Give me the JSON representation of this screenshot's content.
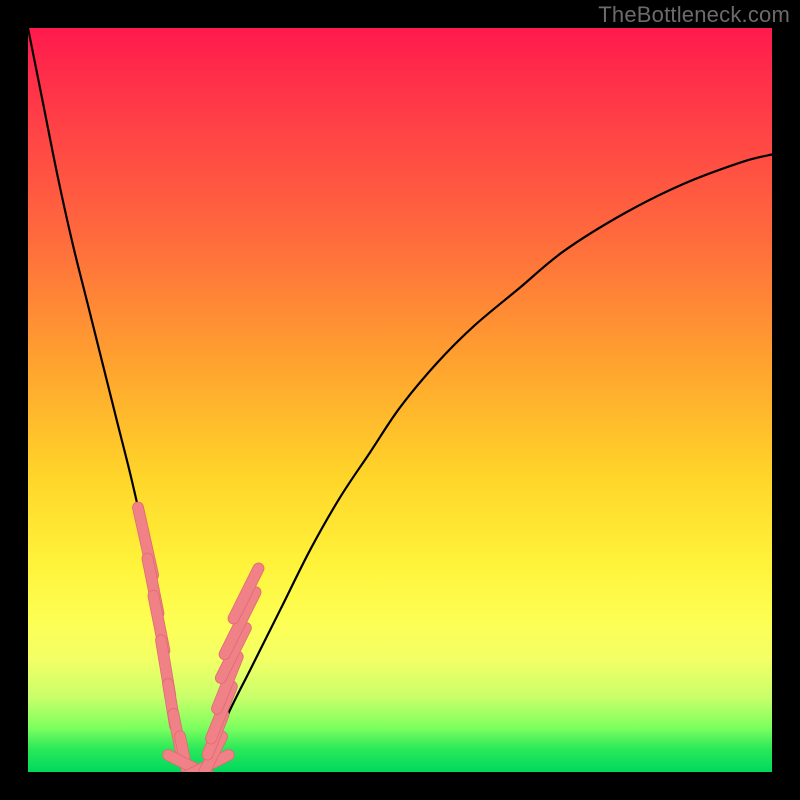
{
  "watermark": "TheBottleneck.com",
  "colors": {
    "frame": "#000000",
    "gradient_top": "#ff1a4d",
    "gradient_mid": "#ffd429",
    "gradient_bottom": "#00d95c",
    "curve": "#000000",
    "marker_fill": "#ef8187",
    "marker_stroke": "#e06a72"
  },
  "chart_data": {
    "type": "line",
    "title": "",
    "xlabel": "",
    "ylabel": "",
    "xlim": [
      0,
      100
    ],
    "ylim": [
      0,
      100
    ],
    "grid": false,
    "legend": null,
    "series": [
      {
        "name": "curve",
        "x": [
          0,
          2,
          4,
          6,
          8,
          10,
          12,
          14,
          16,
          18,
          19,
          20,
          21,
          22,
          23,
          24,
          25,
          27,
          30,
          34,
          38,
          42,
          46,
          50,
          55,
          60,
          66,
          72,
          80,
          88,
          96,
          100
        ],
        "y": [
          100,
          90,
          80,
          71,
          63,
          55,
          47,
          39,
          30,
          20,
          14,
          8,
          3,
          1,
          0.5,
          1,
          3,
          8,
          14,
          22,
          30,
          37,
          43,
          49,
          55,
          60,
          65,
          70,
          75,
          79,
          82,
          83
        ]
      }
    ],
    "markers": {
      "name": "highlighted-points",
      "note": "Salmon pill-shaped markers clustered near the bottom of the V (approx x≈15–28, y≈0–30).",
      "points": [
        {
          "x": 15.8,
          "y": 31,
          "len": 6
        },
        {
          "x": 16.8,
          "y": 25,
          "len": 5
        },
        {
          "x": 17.6,
          "y": 20,
          "len": 5
        },
        {
          "x": 18.5,
          "y": 14,
          "len": 5
        },
        {
          "x": 19.3,
          "y": 9,
          "len": 4
        },
        {
          "x": 20.1,
          "y": 5,
          "len": 4
        },
        {
          "x": 21.0,
          "y": 2,
          "len": 4
        },
        {
          "x": 22.2,
          "y": 0.6,
          "len": 5
        },
        {
          "x": 23.6,
          "y": 0.6,
          "len": 5
        },
        {
          "x": 24.8,
          "y": 2.2,
          "len": 4
        },
        {
          "x": 25.2,
          "y": 5,
          "len": 4
        },
        {
          "x": 26.0,
          "y": 8,
          "len": 5
        },
        {
          "x": 26.8,
          "y": 12,
          "len": 5
        },
        {
          "x": 27.6,
          "y": 16,
          "len": 5
        },
        {
          "x": 28.5,
          "y": 20,
          "len": 6
        },
        {
          "x": 29.3,
          "y": 24,
          "len": 5
        }
      ]
    }
  }
}
